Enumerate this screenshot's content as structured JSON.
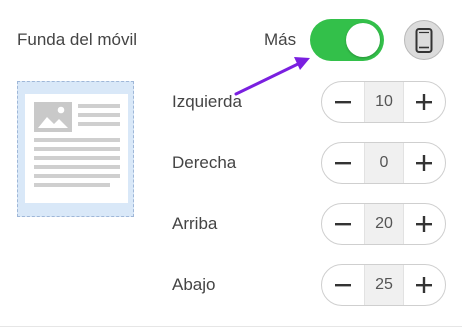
{
  "header": {
    "title": "Funda del móvil",
    "more_label": "Más",
    "toggle_on": true,
    "toggle_color": "#33c04a"
  },
  "icons": {
    "device": "smartphone-icon",
    "annotation": "arrow-icon",
    "preview": "page-layout-preview"
  },
  "margins": [
    {
      "label": "Izquierda",
      "value": "10"
    },
    {
      "label": "Derecha",
      "value": "0"
    },
    {
      "label": "Arriba",
      "value": "20"
    },
    {
      "label": "Abajo",
      "value": "25"
    }
  ],
  "colors": {
    "accent_arrow": "#7a1fe0",
    "preview_bg": "#d9e8f8"
  }
}
